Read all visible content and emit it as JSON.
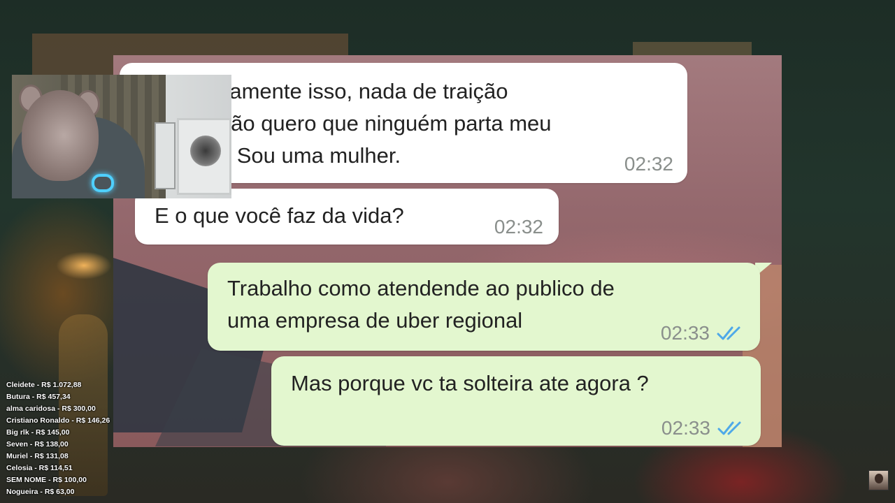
{
  "chat": {
    "messages": [
      {
        "direction": "in",
        "lines": [
          "xatamente isso, nada de traição",
          "e não quero que ninguém parta meu",
          "ão. Sou uma mulher."
        ],
        "time": "02:32"
      },
      {
        "direction": "in",
        "lines": [
          "E o que você faz da vida?"
        ],
        "time": "02:32"
      },
      {
        "direction": "out",
        "lines": [
          "Trabalho como atendende ao publico de",
          "uma empresa de uber regional"
        ],
        "time": "02:33",
        "status": "read"
      },
      {
        "direction": "out",
        "lines": [
          "Mas porque vc ta solteira ate agora ?"
        ],
        "time": "02:33",
        "status": "read"
      }
    ],
    "colors": {
      "incoming": "#ffffff",
      "outgoing": "#e3f7cf",
      "read_ticks": "#4fa9e8",
      "time_text": "#8a8f8c"
    }
  },
  "donations": [
    "Cleidete - R$ 1.072,88",
    "Butura - R$ 457,34",
    "alma caridosa - R$ 300,00",
    "Cristiano Ronaldo - R$ 146,26",
    "Big rlk - R$ 145,00",
    "Seven - R$ 138,00",
    "Muriel - R$ 131,08",
    "Celosia - R$ 114,51",
    "SEM NOME - R$ 100,00",
    "Nogueira - R$ 63,00"
  ]
}
